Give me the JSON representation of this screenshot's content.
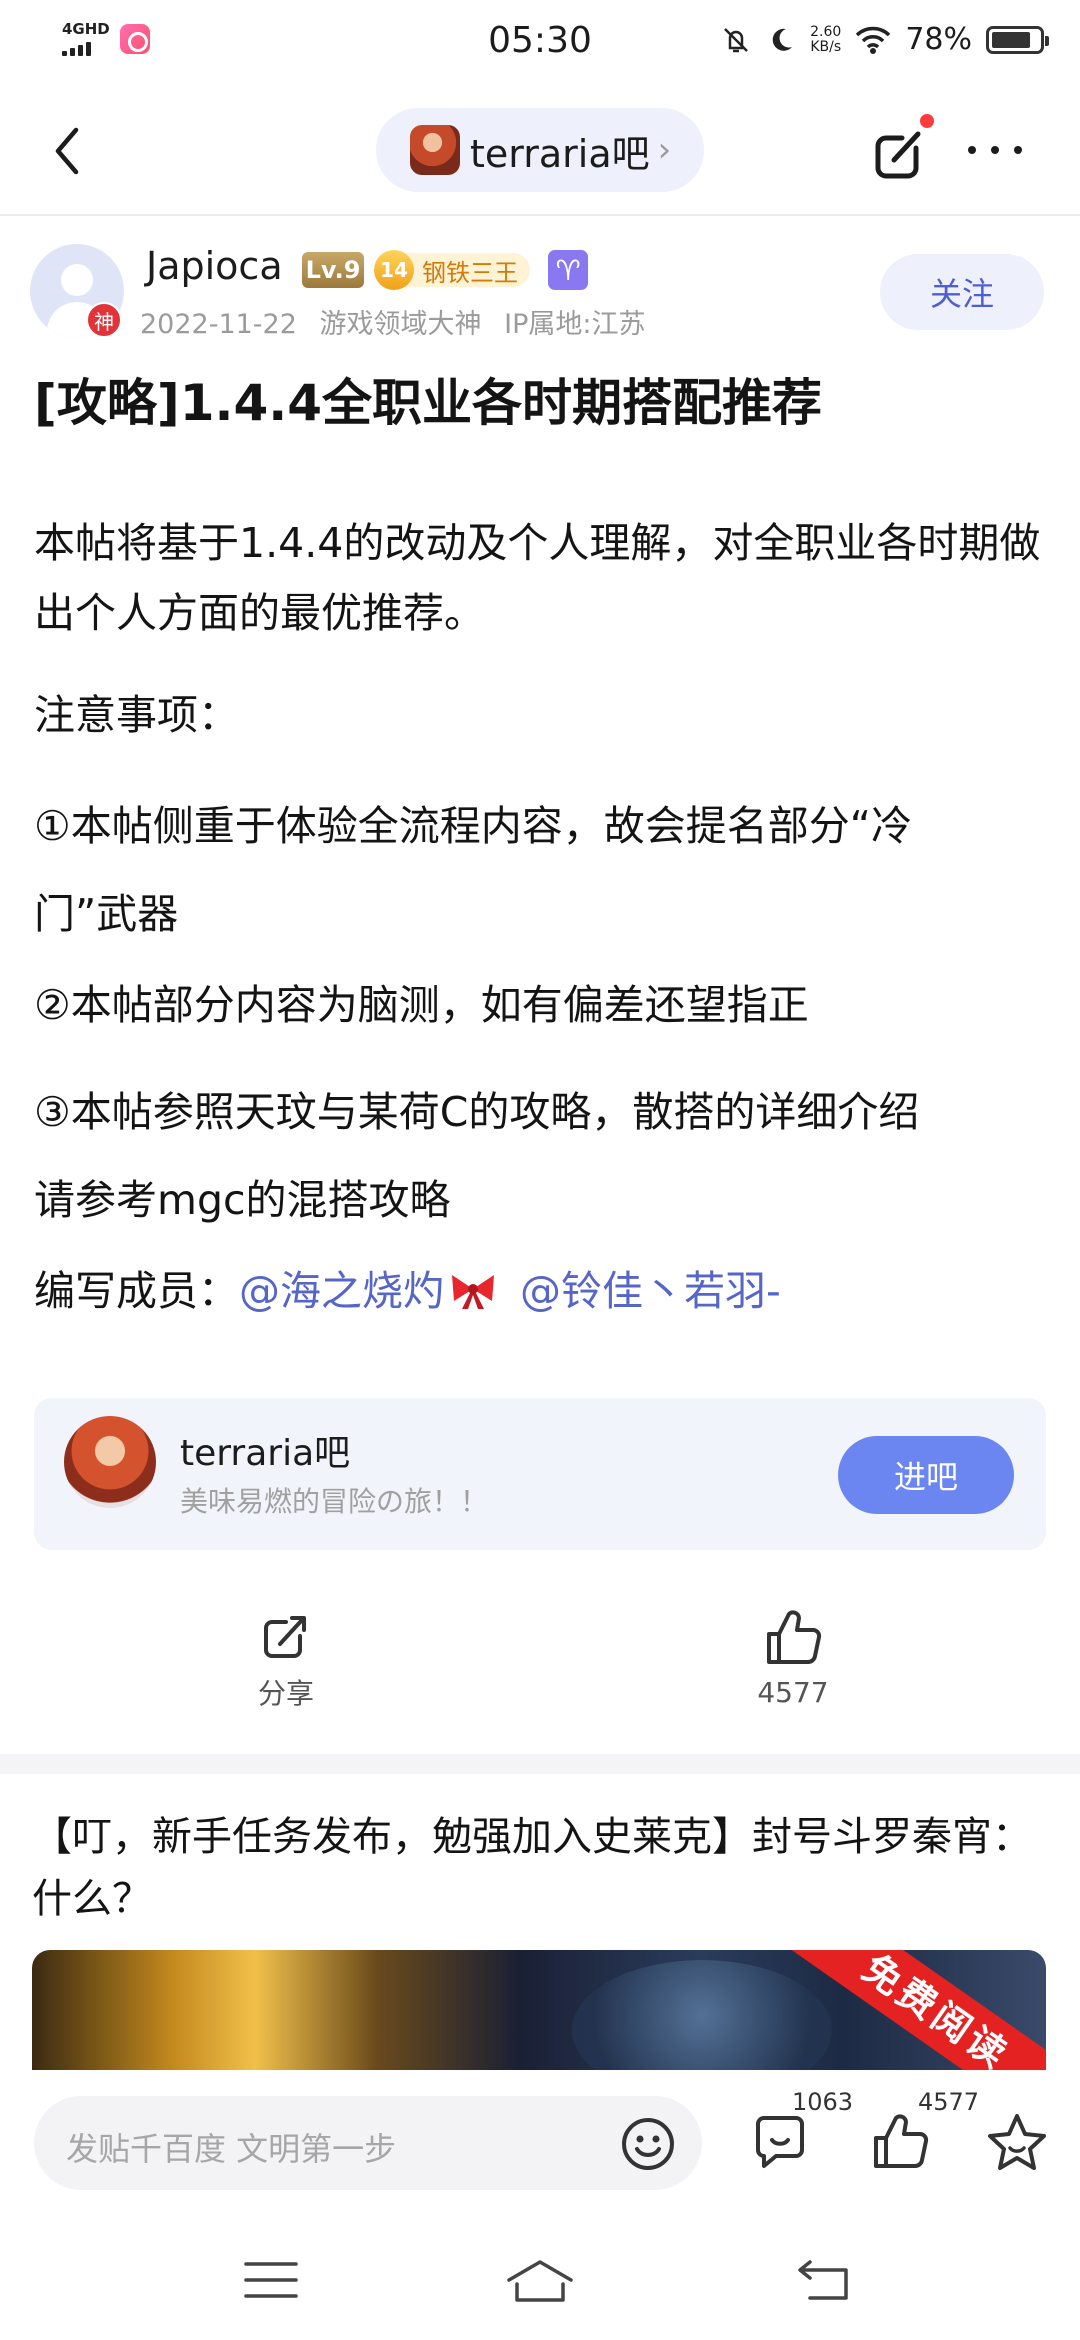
{
  "status_bar": {
    "network": "4GHD",
    "time": "05:30",
    "speed_value": "2.60",
    "speed_unit": "KB/s",
    "battery": "78%"
  },
  "nav": {
    "forum_name": "terraria吧",
    "back_icon": "back-arrow-icon",
    "edit_icon": "edit-icon",
    "more_icon": "more-icon"
  },
  "author": {
    "name": "Japioca",
    "god_badge": "神",
    "level": "Lv.9",
    "title_level": "14",
    "title": "钢铁三王",
    "zodiac": "♈",
    "date": "2022-11-22",
    "honor": "游戏领域大神",
    "ip": "IP属地:江苏",
    "follow_label": "关注"
  },
  "post": {
    "title": "[攻略]1.4.4全职业各时期搭配推荐",
    "intro": "本帖将基于1.4.4的改动及个人理解，对全职业各时期做出个人方面的最优推荐。",
    "notes_heading": "注意事项：",
    "note1": "①本帖侧重于体验全流程内容，故会提名部分“冷门”武器",
    "note2": "②本帖部分内容为脑测，如有偏差还望指正",
    "note3": "③本帖参照天玟与某荷C的攻略，散搭的详细介绍请参考mgc的混搭攻略",
    "authors_label": "编写成员：",
    "mention1": "@海之烧灼",
    "mention2": "@铃佳丶若羽-"
  },
  "forum_card": {
    "name": "terraria吧",
    "description": "美味易燃的冒险の旅！！",
    "enter_label": "进吧"
  },
  "actions": {
    "share_label": "分享",
    "like_count": "4577"
  },
  "recommendation": {
    "title": "【叮，新手任务发布，勉强加入史莱克】封号斗罗秦宵：什么？",
    "ribbon": "免费阅读"
  },
  "bottom_bar": {
    "placeholder": "发贴千百度 文明第一步",
    "comment_count": "1063",
    "like_count": "4577"
  },
  "colors": {
    "accent": "#6b86f0",
    "mention": "#5565c8",
    "pill_bg": "#eef0fb",
    "red_dot": "#ff3b3b"
  }
}
